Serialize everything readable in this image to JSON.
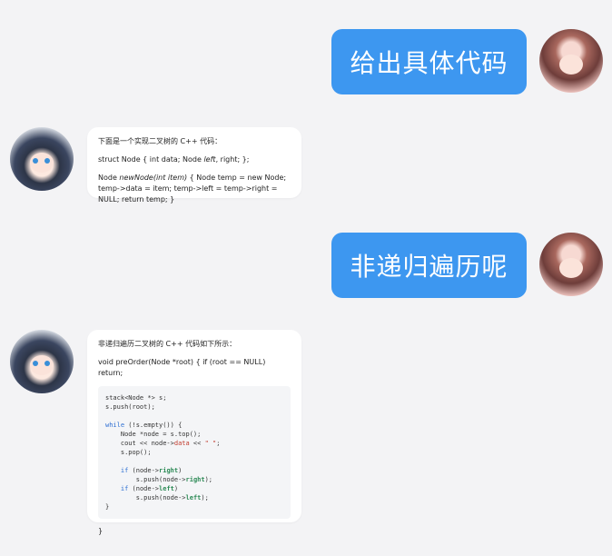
{
  "messages": [
    {
      "role": "user",
      "text": "给出具体代码"
    },
    {
      "role": "bot",
      "intro": "下面是一个实现二叉树的 C++ 代码：",
      "line1": "struct Node { int data; Node left, right; };",
      "line2": "Node newNode(int item) { Node temp = new Node; temp->data = item; temp->left = temp->right = NULL; return temp; }"
    },
    {
      "role": "user",
      "text": "非递归遍历呢"
    },
    {
      "role": "bot",
      "intro": "非递归遍历二叉树的 C++ 代码如下所示：",
      "line1": "void preOrder(Node *root) { if (root == NULL) return;",
      "code": [
        "stack<Node *> s;",
        "s.push(root);",
        "",
        "while (!s.empty()) {",
        "    Node *node = s.top();",
        "    cout << node->data << \" \";",
        "    s.pop();",
        "",
        "    if (node->right)",
        "        s.push(node->right);",
        "    if (node->left)",
        "        s.push(node->left);",
        "}"
      ],
      "closing": "}"
    }
  ],
  "colors": {
    "background": "#f3f3f5",
    "user_bubble": "#3d97f0",
    "bot_bubble": "#ffffff"
  }
}
